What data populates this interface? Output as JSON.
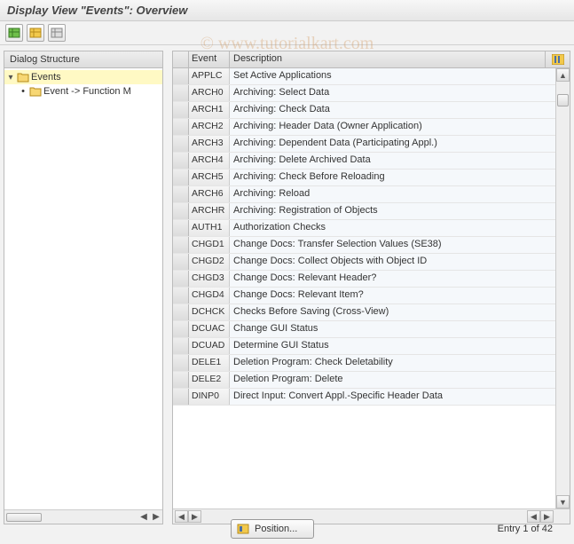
{
  "title": "Display View \"Events\": Overview",
  "watermark": "© www.tutorialkart.com",
  "tree": {
    "header": "Dialog Structure",
    "items": [
      {
        "label": "Events",
        "selected": true,
        "expandable": true
      },
      {
        "label": "Event -> Function M",
        "selected": false,
        "expandable": false
      }
    ]
  },
  "table": {
    "headers": {
      "event": "Event",
      "description": "Description"
    },
    "rows": [
      {
        "event": "APPLC",
        "description": "Set Active Applications"
      },
      {
        "event": "ARCH0",
        "description": "Archiving: Select Data"
      },
      {
        "event": "ARCH1",
        "description": "Archiving: Check Data"
      },
      {
        "event": "ARCH2",
        "description": "Archiving: Header Data (Owner Application)"
      },
      {
        "event": "ARCH3",
        "description": "Archiving: Dependent Data (Participating Appl.)"
      },
      {
        "event": "ARCH4",
        "description": "Archiving: Delete Archived Data"
      },
      {
        "event": "ARCH5",
        "description": "Archiving: Check Before Reloading"
      },
      {
        "event": "ARCH6",
        "description": "Archiving: Reload"
      },
      {
        "event": "ARCHR",
        "description": "Archiving: Registration of Objects"
      },
      {
        "event": "AUTH1",
        "description": "Authorization Checks"
      },
      {
        "event": "CHGD1",
        "description": "Change Docs: Transfer Selection Values (SE38)"
      },
      {
        "event": "CHGD2",
        "description": "Change Docs: Collect Objects with Object ID"
      },
      {
        "event": "CHGD3",
        "description": "Change Docs: Relevant Header?"
      },
      {
        "event": "CHGD4",
        "description": "Change Docs: Relevant Item?"
      },
      {
        "event": "DCHCK",
        "description": "Checks Before Saving (Cross-View)"
      },
      {
        "event": "DCUAC",
        "description": "Change GUI Status"
      },
      {
        "event": "DCUAD",
        "description": "Determine GUI Status"
      },
      {
        "event": "DELE1",
        "description": "Deletion Program: Check Deletability"
      },
      {
        "event": "DELE2",
        "description": "Deletion Program: Delete"
      },
      {
        "event": "DINP0",
        "description": "Direct Input: Convert Appl.-Specific Header Data"
      }
    ]
  },
  "footer": {
    "position_label": "Position...",
    "entry_info": "Entry 1 of 42"
  }
}
